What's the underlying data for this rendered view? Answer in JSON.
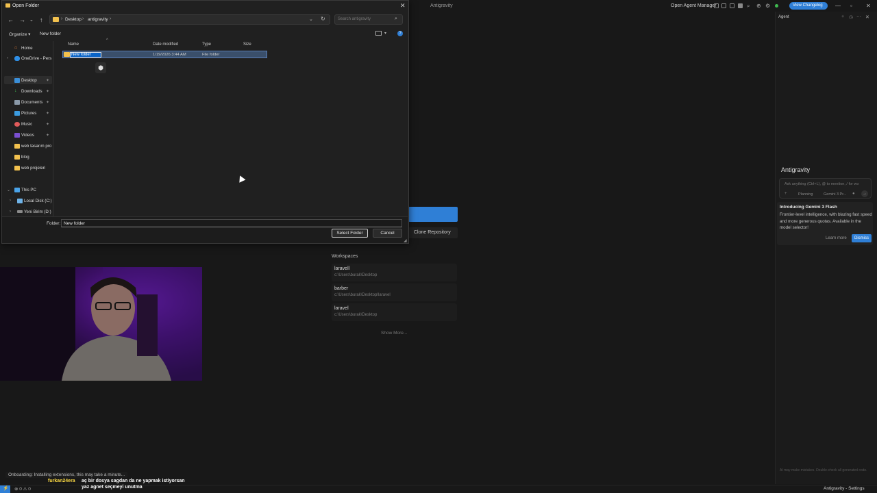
{
  "ide": {
    "window_title": "Antigravity",
    "agent_manager_label": "Open Agent Manager",
    "changelog_label": "View Changelog",
    "win_min": "—",
    "win_max": "▫",
    "win_close": "✕"
  },
  "agent_panel": {
    "title": "Agent",
    "name": "Antigravity",
    "input_placeholder": "Ask anything (Ctrl+L), @ to mention, / for wo",
    "mode": "Planning",
    "model": "Gemini 3 Pr...",
    "card_title": "Introducing Gemini 3 Flash",
    "card_body": "Frontier-level intelligence, with blazing fast speed and more generous quotas. Available in the model selector!",
    "learn_more": "Learn more",
    "dismiss": "Dismiss",
    "disclaimer": "AI may make mistakes. Double-check all generated code."
  },
  "welcome": {
    "clone_label": "Clone Repository",
    "workspaces_heading": "Workspaces",
    "workspaces": [
      {
        "name": "laravell",
        "path": "c:\\Users\\burak\\Desktop"
      },
      {
        "name": "barber",
        "path": "c:\\Users\\burak\\Desktop\\laravel"
      },
      {
        "name": "laravel",
        "path": "c:\\Users\\burak\\Desktop"
      }
    ],
    "show_more": "Show More..."
  },
  "dialog": {
    "title": "Open Folder",
    "close": "✕",
    "breadcrumb": [
      "Desktop",
      "antigravity"
    ],
    "search_placeholder": "Search antigravity",
    "organize": "Organize ▾",
    "new_folder": "New folder",
    "nav": {
      "home": "Home",
      "onedrive": "OneDrive - Pers",
      "desktop": "Desktop",
      "downloads": "Downloads",
      "documents": "Documents",
      "pictures": "Pictures",
      "music": "Music",
      "videos": "Videos",
      "web_tasarim": "web tasarım pro",
      "blog": "blog",
      "web_projeleri": "web projeleri",
      "this_pc": "This PC",
      "local_disk": "Local Disk (C:)",
      "yeni_birim": "Yeni Birim (D:)"
    },
    "columns": {
      "name": "Name",
      "date": "Date modified",
      "type": "Type",
      "size": "Size"
    },
    "rows": [
      {
        "name": "New folder",
        "date": "1/19/2026 3:44 AM",
        "type": "File folder",
        "size": ""
      }
    ],
    "folder_label": "Folder:",
    "folder_value": "New folder",
    "select_button": "Select Folder",
    "cancel_button": "Cancel"
  },
  "overlay": {
    "onboarding": "Onboarding: Installing extensions, this may take a minute...",
    "chat_user": "furkan24era",
    "chat_line1": "aç bir dosya sagdan da ne yapmak istiyorsan",
    "chat_line2": "yaz agnet seçmeyi unutma"
  },
  "statusbar": {
    "remote": "⚡",
    "problems": "⊗ 0 ⚠ 0",
    "settings": "Antigravity - Settings"
  }
}
